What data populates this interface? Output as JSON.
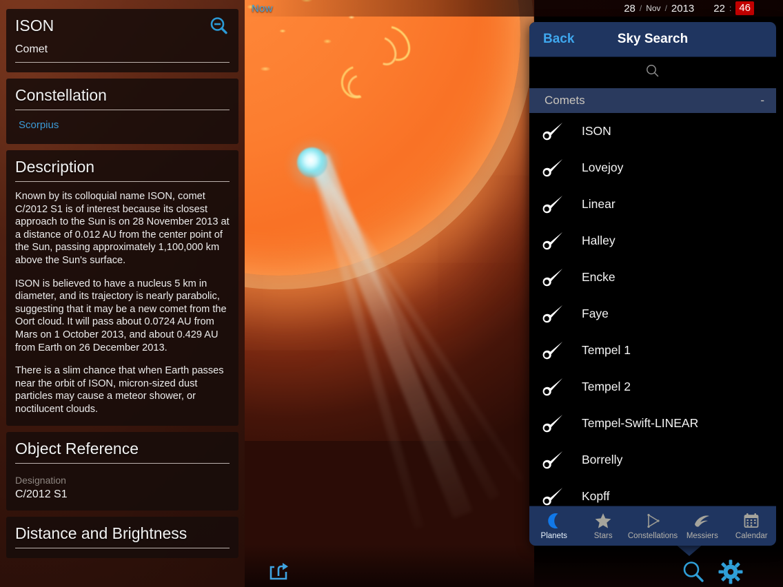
{
  "topbar": {
    "now_label": "Now",
    "day": "28",
    "sep1": "/",
    "month": "Nov",
    "sep2": "/",
    "year": "2013",
    "hour": "22",
    "time_sep": ":",
    "minute": "46"
  },
  "left_panel": {
    "object_name": "ISON",
    "object_type": "Comet",
    "zoom_out_icon": "magnifier-minus-icon",
    "constellation": {
      "title": "Constellation",
      "value": "Scorpius"
    },
    "description": {
      "title": "Description",
      "paragraphs": [
        "Known by its colloquial name ISON, comet C/2012 S1 is of interest because its closest approach to the Sun is on 28 November 2013 at a distance of 0.012 AU from the center point of the Sun, passing approximately 1,100,000 km above the Sun's surface.",
        "ISON is believed to have a nucleus 5 km in diameter, and its trajectory is nearly parabolic, suggesting that it may be a new comet from the Oort cloud. It will pass about 0.0724 AU from Mars on 1 October 2013, and about 0.429 AU from Earth on 26 December 2013.",
        "There is a slim chance that when Earth passes near the orbit of ISON, micron-sized dust particles may cause a meteor shower, or noctilucent clouds."
      ]
    },
    "object_reference": {
      "title": "Object Reference",
      "designation_label": "Designation",
      "designation_value": "C/2012 S1"
    },
    "distance_brightness": {
      "title": "Distance and Brightness"
    }
  },
  "sky_search": {
    "back_label": "Back",
    "title": "Sky Search",
    "search_icon": "search-icon",
    "search_placeholder": "",
    "search_value": "",
    "group": {
      "label": "Comets",
      "collapse_label": "-"
    },
    "items": [
      {
        "name": "ISON",
        "icon": "comet-icon"
      },
      {
        "name": "Lovejoy",
        "icon": "comet-icon"
      },
      {
        "name": "Linear",
        "icon": "comet-icon"
      },
      {
        "name": "Halley",
        "icon": "comet-icon"
      },
      {
        "name": "Encke",
        "icon": "comet-icon"
      },
      {
        "name": "Faye",
        "icon": "comet-icon"
      },
      {
        "name": "Tempel 1",
        "icon": "comet-icon"
      },
      {
        "name": "Tempel 2",
        "icon": "comet-icon"
      },
      {
        "name": "Tempel-Swift-LINEAR",
        "icon": "comet-icon"
      },
      {
        "name": "Borrelly",
        "icon": "comet-icon"
      },
      {
        "name": "Kopff",
        "icon": "comet-icon"
      }
    ],
    "tabs": [
      {
        "label": "Planets",
        "icon": "moon-icon",
        "active": true
      },
      {
        "label": "Stars",
        "icon": "star-icon",
        "active": false
      },
      {
        "label": "Constellations",
        "icon": "triangle-icon",
        "active": false
      },
      {
        "label": "Messiers",
        "icon": "galaxy-icon",
        "active": false
      },
      {
        "label": "Calendar",
        "icon": "calendar-icon",
        "active": false
      }
    ]
  },
  "bottom_bar": {
    "share_icon": "share-icon",
    "search_icon": "search-icon",
    "settings_icon": "gear-icon"
  },
  "colors": {
    "accent_blue": "#3fa7ee",
    "panel_blue": "#1f3560",
    "group_blue": "#2a3a5e",
    "highlight_red": "#c20000",
    "link_blue": "#3b9ad6"
  }
}
